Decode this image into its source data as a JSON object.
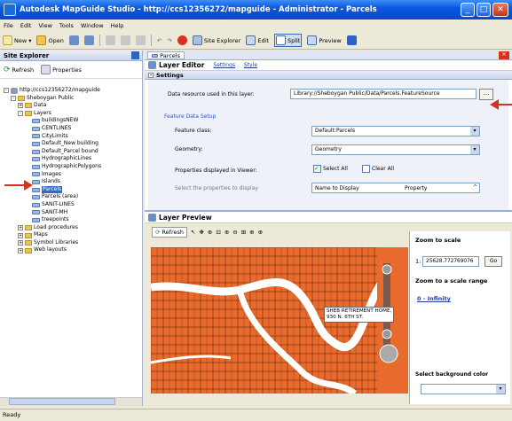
{
  "window": {
    "title": "Autodesk MapGuide Studio - http://ccs12356272/mapguide - Administrator - Parcels"
  },
  "menu": [
    "File",
    "Edit",
    "View",
    "Tools",
    "Window",
    "Help"
  ],
  "toolbar": {
    "new": "New",
    "open": "Open",
    "site_explorer": "Site Explorer",
    "edit": "Edit",
    "split": "Split",
    "preview": "Preview"
  },
  "explorer": {
    "title": "Site Explorer",
    "refresh": "Refresh",
    "properties": "Properties",
    "server": "http://ccs12356272/mapguide",
    "sheboygan": "Sheboygan Public",
    "data": "Data",
    "layers": "Layers",
    "layer_items": [
      "buildingsNEW",
      "CENTLINES",
      "CityLimits",
      "Default_New building",
      "Default_Parcel bound",
      "HydrographicLines",
      "HydrographicPolygons",
      "Images",
      "Islands",
      "Parcels",
      "Parcels (area)",
      "SANIT-LINES",
      "SANIT-MH",
      "treepoints"
    ],
    "selected": "Parcels",
    "folders": [
      "Load procedures",
      "Maps",
      "Symbol Libraries",
      "Web layouts"
    ]
  },
  "tab": {
    "label": "Parcels"
  },
  "editor": {
    "title": "Layer Editor",
    "settings_link": "Settings",
    "style_link": "Style",
    "settings_section": "Settings",
    "data_resource_label": "Data resource used in this layer:",
    "data_resource_value": "Library://Sheboygan Public/Data/Parcels.FeatureSource",
    "browse_button": "...",
    "feature_setup": "Feature Data Setup",
    "feature_class_label": "Feature class:",
    "feature_class_value": "Default:Parcels",
    "geometry_label": "Geometry:",
    "geometry_value": "Geometry",
    "props_label": "Properties displayed in Viewer:",
    "select_all": "Select All",
    "clear_all": "Clear All",
    "select_props_label": "Select the properties to display",
    "col_name": "Name to Display",
    "col_property": "Property"
  },
  "preview": {
    "title": "Layer Preview",
    "refresh": "Refresh",
    "tooltip_line1": "SHEB RETIREMENT HOME,",
    "tooltip_line2": "930 N. 6TH ST.",
    "zoom_to_scale": "Zoom to scale",
    "scale_prefix": "1:",
    "scale_value": "25628.772769076",
    "go": "Go",
    "zoom_range": "Zoom to a scale range",
    "range_link": "0 - Infinity",
    "bg_color": "Select background color"
  },
  "status": "Ready",
  "colors": {
    "map_fill": "#e86a2c",
    "selection": "#316ac5",
    "title_blue": "#0a58e0",
    "river": "#ffffff"
  }
}
